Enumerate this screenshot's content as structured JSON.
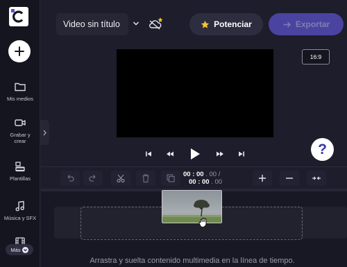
{
  "sidebar": {
    "items": [
      {
        "label": "Mis medios",
        "icon": "folder-icon"
      },
      {
        "label": "Grabar y crear",
        "icon": "video-camera-icon"
      },
      {
        "label": "Plantillas",
        "icon": "templates-icon"
      },
      {
        "label": "Música y SFX",
        "icon": "music-note-icon"
      },
      {
        "label": "Más",
        "icon": "film-icon"
      }
    ],
    "more_label": "Más"
  },
  "header": {
    "project_title": "Video sin título",
    "boost_label": "Potenciar",
    "export_label": "Exportar"
  },
  "preview": {
    "aspect_ratio": "16:9",
    "help_label": "?"
  },
  "timeline": {
    "current_time_main": "00 : 00",
    "current_time_ms": ". 00",
    "separator": "/",
    "total_time_main": "00 : 00",
    "total_time_ms": ". 00",
    "drop_hint": "Arrastra y suelta contenido multimedia en la línea de tiempo."
  },
  "colors": {
    "accent": "#5b50c8",
    "background": "#1d1d2b",
    "sidebar": "#15151f",
    "star": "#f5c431"
  }
}
